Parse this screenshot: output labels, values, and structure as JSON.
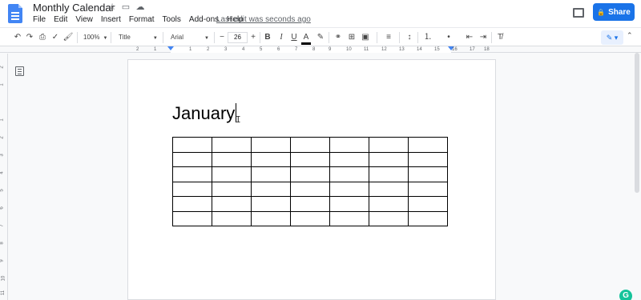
{
  "app": {
    "doc_title": "Monthly Calendar",
    "last_edit": "Last edit was seconds ago",
    "share_label": "Share",
    "menus": [
      "File",
      "Edit",
      "View",
      "Insert",
      "Format",
      "Tools",
      "Add-ons",
      "Help"
    ],
    "title_icons": [
      "star-icon",
      "move-to-folder-icon",
      "cloud-status-icon"
    ]
  },
  "toolbar": {
    "zoom": "100%",
    "style": "Title",
    "font": "Arial",
    "font_size": "26",
    "minus": "−",
    "plus": "+",
    "bold": "B",
    "italic": "I",
    "underline": "U",
    "text_color": "A"
  },
  "ruler": {
    "numbers": [
      "2",
      "1",
      "1",
      "2",
      "3",
      "4",
      "5",
      "6",
      "7",
      "8",
      "9",
      "10",
      "11",
      "12",
      "13",
      "14",
      "15",
      "16",
      "17",
      "18"
    ]
  },
  "vruler": {
    "numbers": [
      "2",
      "1",
      "1",
      "2",
      "3",
      "4",
      "5",
      "6",
      "7",
      "8",
      "9",
      "10",
      "11"
    ]
  },
  "document": {
    "heading": "January",
    "table": {
      "rows": 6,
      "cols": 7
    }
  },
  "grammarly_label": "G",
  "colors": {
    "accent": "#1a73e8",
    "doc_icon": "#4285f4",
    "grammarly": "#15c39a"
  }
}
